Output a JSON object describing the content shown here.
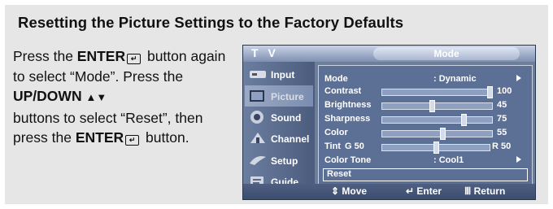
{
  "title": "Resetting the Picture Settings to the Factory Defaults",
  "instructions": {
    "p1": "Press the ",
    "enter": "ENTER",
    "p2": " button again to select “Mode”. Press the ",
    "updown": "UP/DOWN",
    "p3": " buttons to select “Reset”, then press the ",
    "enter2": "ENTER",
    "p4": " button."
  },
  "osd": {
    "header_left": "T V",
    "header_title": "Mode",
    "sidebar": [
      {
        "label": "Input",
        "icon": "input-icon"
      },
      {
        "label": "Picture",
        "icon": "picture-icon",
        "active": true
      },
      {
        "label": "Sound",
        "icon": "sound-icon"
      },
      {
        "label": "Channel",
        "icon": "channel-icon"
      },
      {
        "label": "Setup",
        "icon": "setup-icon"
      },
      {
        "label": "Guide",
        "icon": "guide-icon"
      }
    ],
    "mode": {
      "label": "Mode",
      "value": ": Dynamic"
    },
    "sliders": [
      {
        "label": "Contrast",
        "value": 100,
        "level": 1.0
      },
      {
        "label": "Brightness",
        "value": 45,
        "level": 0.45
      },
      {
        "label": "Sharpness",
        "value": 75,
        "level": 0.75
      },
      {
        "label": "Color",
        "value": 55,
        "level": 0.55
      }
    ],
    "tint": {
      "label": "Tint",
      "left": "G 50",
      "right": "R 50",
      "level": 0.5
    },
    "color_tone": {
      "label": "Color Tone",
      "value": ": Cool1"
    },
    "reset": "Reset",
    "footer": {
      "move": "Move",
      "enter": "Enter",
      "return": "Return"
    }
  }
}
